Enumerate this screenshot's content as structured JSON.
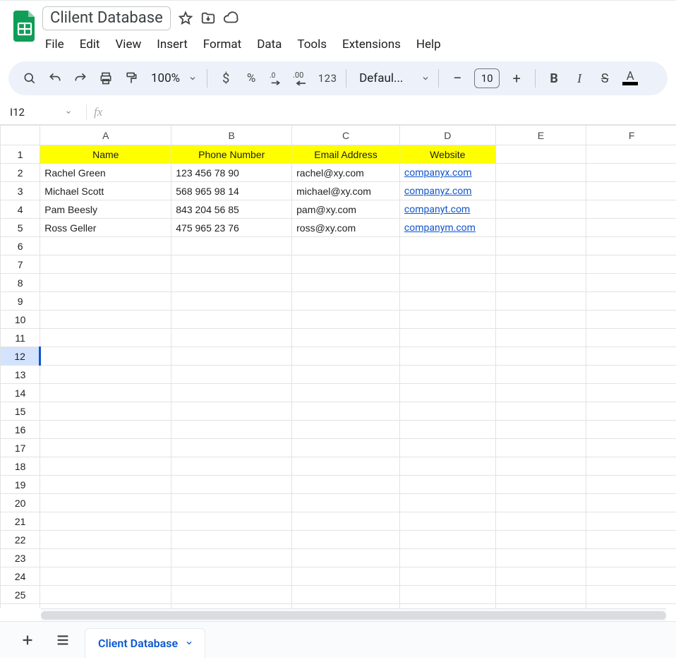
{
  "doc": {
    "title": "Clilent Database"
  },
  "menu": {
    "file": "File",
    "edit": "Edit",
    "view": "View",
    "insert": "Insert",
    "format": "Format",
    "data": "Data",
    "tools": "Tools",
    "extensions": "Extensions",
    "help": "Help"
  },
  "toolbar": {
    "zoom": "100%",
    "currency": "$",
    "percent": "%",
    "f123": "123",
    "font": "Defaul...",
    "font_size": "10"
  },
  "namebox": {
    "value": "I12"
  },
  "columns": {
    "A": "A",
    "B": "B",
    "C": "C",
    "D": "D",
    "E": "E",
    "F": "F"
  },
  "headers": {
    "name": "Name",
    "phone": "Phone Number",
    "email": "Email Address",
    "website": "Website"
  },
  "rows": [
    {
      "name": "Rachel Green",
      "phone": "123 456 78 90",
      "email": "rachel@xy.com",
      "website": "companyx.com"
    },
    {
      "name": "Michael Scott",
      "phone": "568 965 98 14",
      "email": "michael@xy.com",
      "website": "companyz.com"
    },
    {
      "name": "Pam Beesly",
      "phone": "843 204 56 85",
      "email": "pam@xy.com",
      "website": "companyt.com"
    },
    {
      "name": "Ross Geller",
      "phone": "475 965 23 76",
      "email": "ross@xy.com",
      "website": "companym.com"
    }
  ],
  "active_row": 12,
  "sheet_tab": {
    "label": "Client Database"
  }
}
